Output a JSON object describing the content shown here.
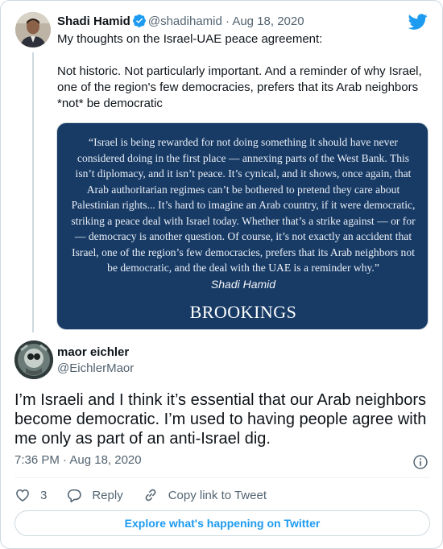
{
  "quoted_tweet": {
    "name": "Shadi Hamid",
    "handle": "@shadihamid",
    "separator": "·",
    "date": "Aug 18, 2020",
    "text_line1": "My thoughts on the Israel-UAE peace agreement:",
    "text_para2": "Not historic. Not particularly important. And a reminder of why Israel, one of the region's few democracies, prefers that its Arab neighbors *not* be democratic",
    "card": {
      "quote": "“Israel is being rewarded for not doing something it should have never considered doing in the first place — annexing parts of the West Bank. This isn’t diplomacy, and it isn’t peace. It’s cynical, and it shows, once again, that Arab authoritarian regimes can’t be bothered to pretend they care about Palestinian rights... It’s hard to imagine an Arab country, if it were democratic, striking a peace deal with Israel today. Whether that’s a strike against — or for — democracy is another question. Of course, it’s not exactly an accident that Israel, one of the region’s few democracies, prefers that its Arab neighbors not be democratic, and the deal with the UAE is a reminder why.”",
      "author": "Shadi Hamid",
      "brand": "BROOKINGS",
      "background": "#183b66"
    }
  },
  "main_tweet": {
    "name": "maor eichler",
    "handle": "@EichlerMaor",
    "text": "I’m Israeli and I think it’s essential that our Arab neighbors become democratic. I’m used to having people agree with me only as part of an anti-Israel dig.",
    "time": "7:36 PM · Aug 18, 2020"
  },
  "actions": {
    "like_count": "3",
    "reply_label": "Reply",
    "copy_label": "Copy link to Tweet"
  },
  "explore_label": "Explore what's happening on Twitter",
  "colors": {
    "accent": "#1d9bf0",
    "text": "#0f1419",
    "secondary": "#536471",
    "border": "#cfd9de"
  },
  "icons": [
    "verified-badge-icon",
    "twitter-bird-icon",
    "info-icon",
    "heart-icon",
    "reply-icon",
    "link-icon"
  ]
}
